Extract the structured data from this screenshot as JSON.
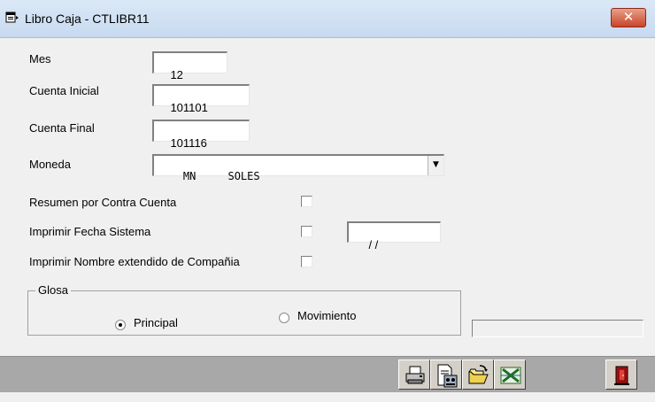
{
  "window": {
    "title": "Libro Caja - CTLIBR11",
    "close_glyph": "✕"
  },
  "form": {
    "mes": {
      "label": "Mes",
      "value": "12"
    },
    "cuenta_inicial": {
      "label": "Cuenta Inicial",
      "value": "101101"
    },
    "cuenta_final": {
      "label": "Cuenta Final",
      "value": "101116"
    },
    "moneda": {
      "label": "Moneda",
      "value": "MN     SOLES",
      "arrow": "▼"
    },
    "resumen": {
      "label": "Resumen por Contra Cuenta",
      "checked": false
    },
    "fecha_sistema": {
      "label": "Imprimir Fecha Sistema",
      "checked": false,
      "date_value": "/ /"
    },
    "nombre_extendido": {
      "label": "Imprimir Nombre extendido de Compañia",
      "checked": false
    }
  },
  "glosa": {
    "legend": "Glosa",
    "options": [
      {
        "label": "Principal",
        "selected": true
      },
      {
        "label": "Movimiento",
        "selected": false
      }
    ]
  },
  "toolbar": {
    "buttons": [
      {
        "name": "print-icon"
      },
      {
        "name": "preview-icon"
      },
      {
        "name": "open-folder-icon"
      },
      {
        "name": "excel-icon"
      },
      {
        "name": "exit-door-icon"
      }
    ]
  },
  "colors": {
    "background": "#f0f0f0",
    "titlebar": "#c7daf0",
    "close_button": "#c9452a",
    "toolbar": "#a8a8a8",
    "button_face": "#d4d0c8"
  }
}
